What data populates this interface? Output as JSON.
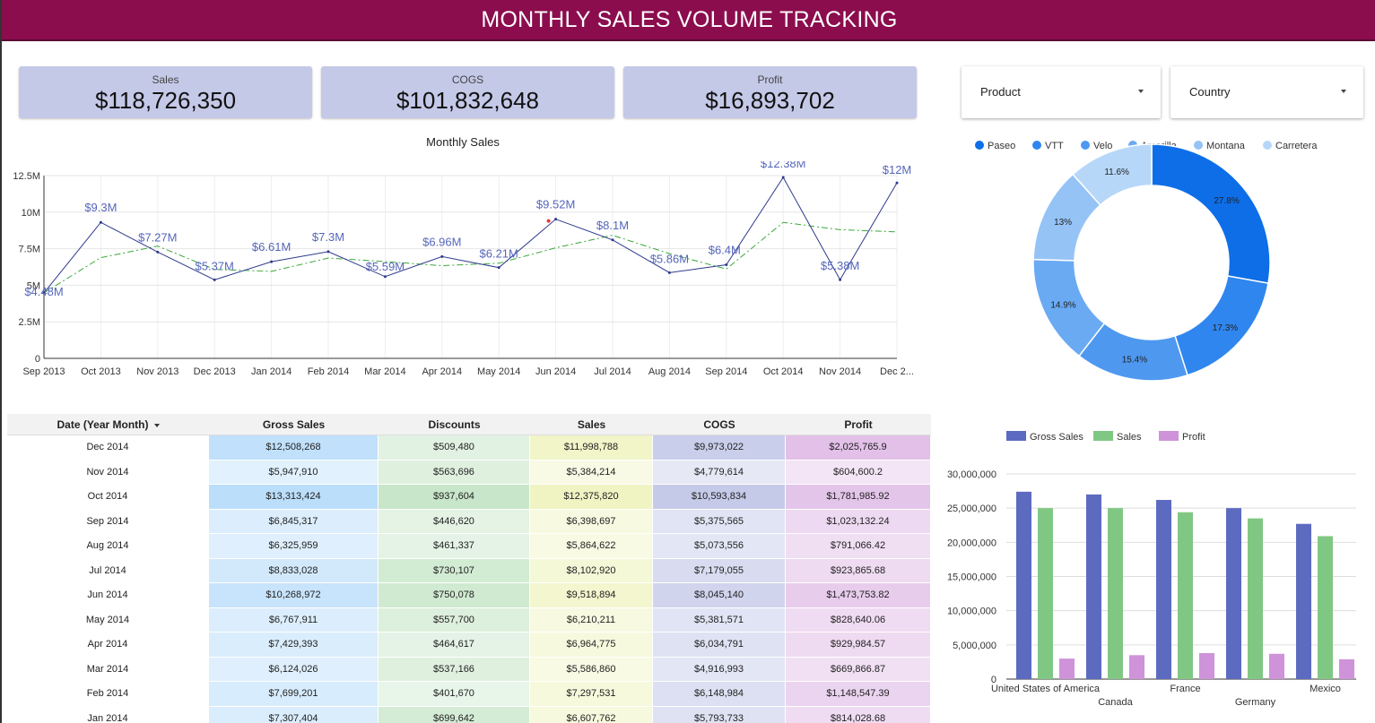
{
  "header": {
    "title": "MONTHLY SALES VOLUME TRACKING"
  },
  "kpis": [
    {
      "label": "Sales",
      "value": "$118,726,350"
    },
    {
      "label": "COGS",
      "value": "$101,832,648"
    },
    {
      "label": "Profit",
      "value": "$16,893,702"
    }
  ],
  "filters": [
    {
      "label": "Product"
    },
    {
      "label": "Country"
    }
  ],
  "colors": {
    "header_bg": "#8b0d4e",
    "kpi_bg": "#c5c9e8",
    "line_series": "#2e3a8c",
    "trend_series": "#3ca83c",
    "label_color": "#5566bb",
    "bar_gross": "#5c6bc0",
    "bar_sales": "#81c784",
    "bar_profit": "#ce93d8",
    "gross_cell": "#bbdefb",
    "discount_cell": "#c8e6c9",
    "sales_cell": "#f0f4c3",
    "cogs_cell": "#c5cae9",
    "profit_cell": "#e1bee7"
  },
  "chart_data": [
    {
      "type": "line",
      "title": "Monthly Sales",
      "x": [
        "Sep 2013",
        "Oct 2013",
        "Nov 2013",
        "Dec 2013",
        "Jan 2014",
        "Feb 2014",
        "Mar 2014",
        "Apr 2014",
        "May 2014",
        "Jun 2014",
        "Jul 2014",
        "Aug 2014",
        "Sep 2014",
        "Oct 2014",
        "Nov 2014",
        "Dec 2..."
      ],
      "series": [
        {
          "values": [
            4.48,
            9.3,
            7.27,
            5.37,
            6.61,
            7.3,
            5.59,
            6.96,
            6.21,
            9.52,
            8.1,
            5.86,
            6.4,
            12.38,
            5.38,
            12.0
          ]
        },
        {
          "values": [
            4.48,
            6.89,
            7.68,
            6.09,
            5.95,
            6.86,
            6.62,
            6.34,
            6.51,
            7.56,
            8.42,
            7.16,
            6.11,
            9.3,
            8.8,
            8.65
          ]
        }
      ],
      "data_labels": [
        "$4.48M",
        "$9.3M",
        "$7.27M",
        "$5.37M",
        "$6.61M",
        "$7.3M",
        "$5.59M",
        "$6.96M",
        "$6.21M",
        "$9.52M",
        "$8.1M",
        "$5.86M",
        "$6.4M",
        "$12.38M",
        "$5.38M",
        "$12M"
      ],
      "y_ticks": [
        "0",
        "2.5M",
        "5M",
        "7.5M",
        "10M",
        "12.5M"
      ],
      "ylim": [
        0,
        12.5
      ],
      "grid": true
    },
    {
      "type": "pie",
      "categories": [
        "Paseo",
        "VTT",
        "Velo",
        "Amarilla",
        "Montana",
        "Carretera"
      ],
      "values": [
        27.8,
        17.3,
        15.4,
        14.9,
        13,
        11.6
      ],
      "labels": [
        "27.8%",
        "17.3%",
        "15.4%",
        "14.9%",
        "13%",
        "11.6%"
      ],
      "colors": [
        "#0d6ee8",
        "#2f86ee",
        "#4e98f0",
        "#6aaaf3",
        "#95c3f6",
        "#b7d7f9"
      ],
      "legend": "top"
    },
    {
      "type": "bar",
      "categories": [
        "United States of America",
        "Canada",
        "France",
        "Germany",
        "Mexico"
      ],
      "series": [
        {
          "name": "Gross Sales",
          "values": [
            27400000,
            27000000,
            26200000,
            25000000,
            22700000
          ]
        },
        {
          "name": "Sales",
          "values": [
            25000000,
            25000000,
            24400000,
            23500000,
            20900000
          ]
        },
        {
          "name": "Profit",
          "values": [
            3000000,
            3500000,
            3800000,
            3700000,
            2900000
          ]
        }
      ],
      "y_ticks": [
        "0",
        "5,000,000",
        "10,000,000",
        "15,000,000",
        "20,000,000",
        "25,000,000",
        "30,000,000"
      ],
      "ylim": [
        0,
        30000000
      ],
      "legend": "top"
    }
  ],
  "table": {
    "headers": [
      "Date (Year Month)",
      "Gross Sales",
      "Discounts",
      "Sales",
      "COGS",
      "Profit"
    ],
    "rows": [
      [
        "Dec 2014",
        "$12,508,268",
        "$509,480",
        "$11,998,788",
        "$9,973,022",
        "$2,025,765.9"
      ],
      [
        "Nov 2014",
        "$5,947,910",
        "$563,696",
        "$5,384,214",
        "$4,779,614",
        "$604,600.2"
      ],
      [
        "Oct 2014",
        "$13,313,424",
        "$937,604",
        "$12,375,820",
        "$10,593,834",
        "$1,781,985.92"
      ],
      [
        "Sep 2014",
        "$6,845,317",
        "$446,620",
        "$6,398,697",
        "$5,375,565",
        "$1,023,132.24"
      ],
      [
        "Aug 2014",
        "$6,325,959",
        "$461,337",
        "$5,864,622",
        "$5,073,556",
        "$791,066.42"
      ],
      [
        "Jul 2014",
        "$8,833,028",
        "$730,107",
        "$8,102,920",
        "$7,179,055",
        "$923,865.68"
      ],
      [
        "Jun 2014",
        "$10,268,972",
        "$750,078",
        "$9,518,894",
        "$8,045,140",
        "$1,473,753.82"
      ],
      [
        "May 2014",
        "$6,767,911",
        "$557,700",
        "$6,210,211",
        "$5,381,571",
        "$828,640.06"
      ],
      [
        "Apr 2014",
        "$7,429,393",
        "$464,617",
        "$6,964,775",
        "$6,034,791",
        "$929,984.57"
      ],
      [
        "Mar 2014",
        "$6,124,026",
        "$537,166",
        "$5,586,860",
        "$4,916,993",
        "$669,866.87"
      ],
      [
        "Feb 2014",
        "$7,699,201",
        "$401,670",
        "$7,297,531",
        "$6,148,984",
        "$1,148,547.39"
      ],
      [
        "Jan 2014",
        "$7,307,404",
        "$699,642",
        "$6,607,762",
        "$5,793,733",
        "$814,028.68"
      ]
    ],
    "intensity": [
      [
        0.9,
        0.38,
        0.9,
        0.9,
        0.95
      ],
      [
        0.25,
        0.45,
        0.25,
        0.25,
        0.2
      ],
      [
        1.0,
        1.0,
        1.0,
        1.0,
        0.85
      ],
      [
        0.35,
        0.3,
        0.35,
        0.35,
        0.45
      ],
      [
        0.3,
        0.32,
        0.3,
        0.3,
        0.35
      ],
      [
        0.55,
        0.75,
        0.55,
        0.55,
        0.42
      ],
      [
        0.75,
        0.8,
        0.75,
        0.75,
        0.72
      ],
      [
        0.35,
        0.5,
        0.35,
        0.35,
        0.4
      ],
      [
        0.4,
        0.32,
        0.4,
        0.4,
        0.42
      ],
      [
        0.3,
        0.45,
        0.3,
        0.3,
        0.3
      ],
      [
        0.45,
        0.22,
        0.45,
        0.45,
        0.55
      ],
      [
        0.4,
        0.7,
        0.4,
        0.4,
        0.38
      ]
    ]
  }
}
